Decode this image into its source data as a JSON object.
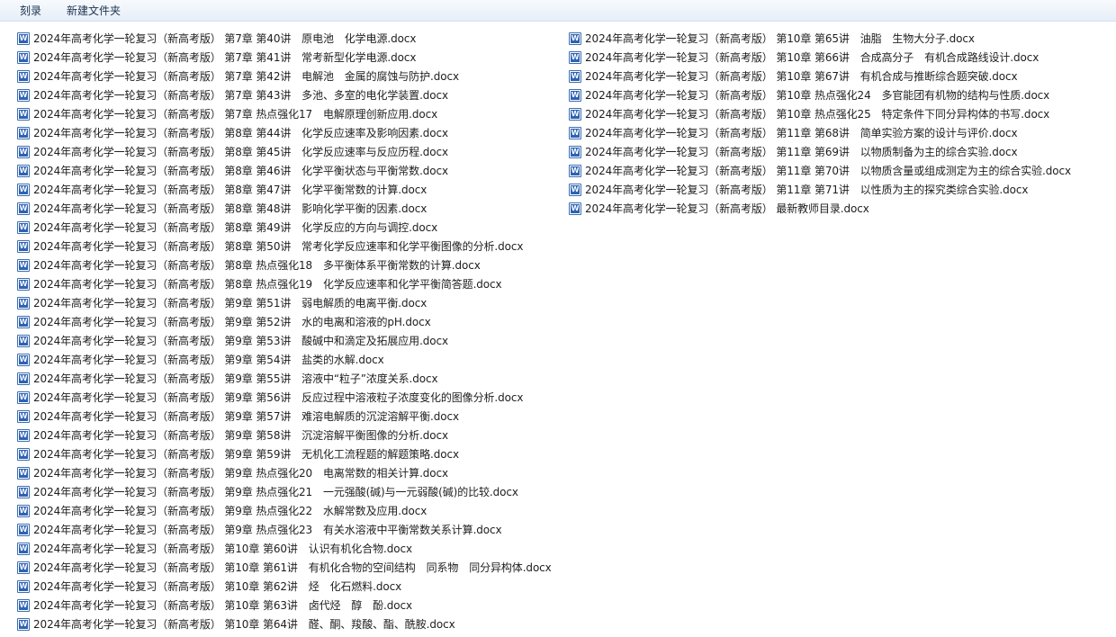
{
  "toolbar": {
    "burn_label": "刻录",
    "new_folder_label": "新建文件夹"
  },
  "files_left": [
    "2024年高考化学一轮复习（新高考版） 第7章 第40讲　原电池　化学电源.docx",
    "2024年高考化学一轮复习（新高考版） 第7章 第41讲　常考新型化学电源.docx",
    "2024年高考化学一轮复习（新高考版） 第7章 第42讲　电解池　金属的腐蚀与防护.docx",
    "2024年高考化学一轮复习（新高考版） 第7章 第43讲　多池、多室的电化学装置.docx",
    "2024年高考化学一轮复习（新高考版） 第7章 热点强化17　电解原理创新应用.docx",
    "2024年高考化学一轮复习（新高考版） 第8章 第44讲　化学反应速率及影响因素.docx",
    "2024年高考化学一轮复习（新高考版） 第8章 第45讲　化学反应速率与反应历程.docx",
    "2024年高考化学一轮复习（新高考版） 第8章 第46讲　化学平衡状态与平衡常数.docx",
    "2024年高考化学一轮复习（新高考版） 第8章 第47讲　化学平衡常数的计算.docx",
    "2024年高考化学一轮复习（新高考版） 第8章 第48讲　影响化学平衡的因素.docx",
    "2024年高考化学一轮复习（新高考版） 第8章 第49讲　化学反应的方向与调控.docx",
    "2024年高考化学一轮复习（新高考版） 第8章 第50讲　常考化学反应速率和化学平衡图像的分析.docx",
    "2024年高考化学一轮复习（新高考版） 第8章 热点强化18　多平衡体系平衡常数的计算.docx",
    "2024年高考化学一轮复习（新高考版） 第8章 热点强化19　化学反应速率和化学平衡简答题.docx",
    "2024年高考化学一轮复习（新高考版） 第9章 第51讲　弱电解质的电离平衡.docx",
    "2024年高考化学一轮复习（新高考版） 第9章 第52讲　水的电离和溶液的pH.docx",
    "2024年高考化学一轮复习（新高考版） 第9章 第53讲　酸碱中和滴定及拓展应用.docx",
    "2024年高考化学一轮复习（新高考版） 第9章 第54讲　盐类的水解.docx",
    "2024年高考化学一轮复习（新高考版） 第9章 第55讲　溶液中“粒子”浓度关系.docx",
    "2024年高考化学一轮复习（新高考版） 第9章 第56讲　反应过程中溶液粒子浓度变化的图像分析.docx",
    "2024年高考化学一轮复习（新高考版） 第9章 第57讲　难溶电解质的沉淀溶解平衡.docx",
    "2024年高考化学一轮复习（新高考版） 第9章 第58讲　沉淀溶解平衡图像的分析.docx",
    "2024年高考化学一轮复习（新高考版） 第9章 第59讲　无机化工流程题的解题策略.docx",
    "2024年高考化学一轮复习（新高考版） 第9章 热点强化20　电离常数的相关计算.docx",
    "2024年高考化学一轮复习（新高考版） 第9章 热点强化21　一元强酸(碱)与一元弱酸(碱)的比较.docx",
    "2024年高考化学一轮复习（新高考版） 第9章 热点强化22　水解常数及应用.docx",
    "2024年高考化学一轮复习（新高考版） 第9章 热点强化23　有关水溶液中平衡常数关系计算.docx",
    "2024年高考化学一轮复习（新高考版） 第10章 第60讲　认识有机化合物.docx",
    "2024年高考化学一轮复习（新高考版） 第10章 第61讲　有机化合物的空间结构　同系物　同分异构体.docx",
    "2024年高考化学一轮复习（新高考版） 第10章 第62讲　烃　化石燃料.docx",
    "2024年高考化学一轮复习（新高考版） 第10章 第63讲　卤代烃　醇　酚.docx",
    "2024年高考化学一轮复习（新高考版） 第10章 第64讲　醛、酮、羧酸、酯、酰胺.docx"
  ],
  "files_right": [
    "2024年高考化学一轮复习（新高考版） 第10章 第65讲　油脂　生物大分子.docx",
    "2024年高考化学一轮复习（新高考版） 第10章 第66讲　合成高分子　有机合成路线设计.docx",
    "2024年高考化学一轮复习（新高考版） 第10章 第67讲　有机合成与推断综合题突破.docx",
    "2024年高考化学一轮复习（新高考版） 第10章 热点强化24　多官能团有机物的结构与性质.docx",
    "2024年高考化学一轮复习（新高考版） 第10章 热点强化25　特定条件下同分异构体的书写.docx",
    "2024年高考化学一轮复习（新高考版） 第11章 第68讲　简单实验方案的设计与评价.docx",
    "2024年高考化学一轮复习（新高考版） 第11章 第69讲　以物质制备为主的综合实验.docx",
    "2024年高考化学一轮复习（新高考版） 第11章 第70讲　以物质含量或组成测定为主的综合实验.docx",
    "2024年高考化学一轮复习（新高考版） 第11章 第71讲　以性质为主的探究类综合实验.docx",
    "2024年高考化学一轮复习（新高考版） 最新教师目录.docx"
  ],
  "icon": {
    "file_icon": "word-document-icon"
  }
}
